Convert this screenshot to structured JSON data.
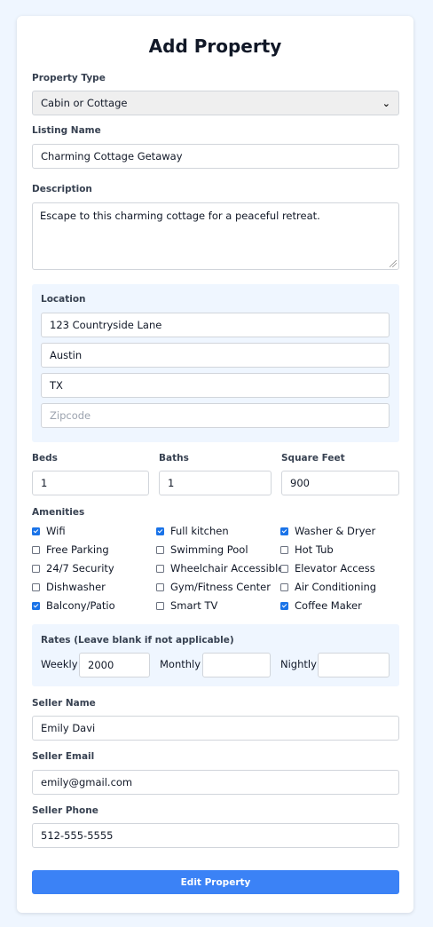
{
  "form": {
    "title": "Add Property",
    "property_type": {
      "label": "Property Type",
      "value": "Cabin or Cottage"
    },
    "listing_name": {
      "label": "Listing Name",
      "value": "Charming Cottage Getaway"
    },
    "description": {
      "label": "Description",
      "value": "Escape to this charming cottage for a peaceful retreat."
    },
    "location": {
      "label": "Location",
      "street": "123 Countryside Lane",
      "city": "Austin",
      "state": "TX",
      "zipcode_placeholder": "Zipcode"
    },
    "beds": {
      "label": "Beds",
      "value": "1"
    },
    "baths": {
      "label": "Baths",
      "value": "1"
    },
    "square_feet": {
      "label": "Square Feet",
      "value": "900"
    },
    "amenities": {
      "label": "Amenities",
      "items": [
        {
          "label": "Wifi",
          "checked": true
        },
        {
          "label": "Full kitchen",
          "checked": true
        },
        {
          "label": "Washer & Dryer",
          "checked": true
        },
        {
          "label": "Free Parking",
          "checked": false
        },
        {
          "label": "Swimming Pool",
          "checked": false
        },
        {
          "label": "Hot Tub",
          "checked": false
        },
        {
          "label": "24/7 Security",
          "checked": false
        },
        {
          "label": "Wheelchair Accessible",
          "checked": false
        },
        {
          "label": "Elevator Access",
          "checked": false
        },
        {
          "label": "Dishwasher",
          "checked": false
        },
        {
          "label": "Gym/Fitness Center",
          "checked": false
        },
        {
          "label": "Air Conditioning",
          "checked": false
        },
        {
          "label": "Balcony/Patio",
          "checked": true
        },
        {
          "label": "Smart TV",
          "checked": false
        },
        {
          "label": "Coffee Maker",
          "checked": true
        }
      ]
    },
    "rates": {
      "label": "Rates (Leave blank if not applicable)",
      "weekly_label": "Weekly",
      "weekly_value": "2000",
      "monthly_label": "Monthly",
      "monthly_value": "",
      "nightly_label": "Nightly",
      "nightly_value": ""
    },
    "seller_name": {
      "label": "Seller Name",
      "value": "Emily Davi"
    },
    "seller_email": {
      "label": "Seller Email",
      "value": "emily@gmail.com"
    },
    "seller_phone": {
      "label": "Seller Phone",
      "value": "512-555-5555"
    },
    "submit_label": "Edit Property"
  },
  "colors": {
    "page_background": "#eff6ff",
    "accent": "#3b82f6",
    "checkbox_checked": "#1a73e8"
  }
}
